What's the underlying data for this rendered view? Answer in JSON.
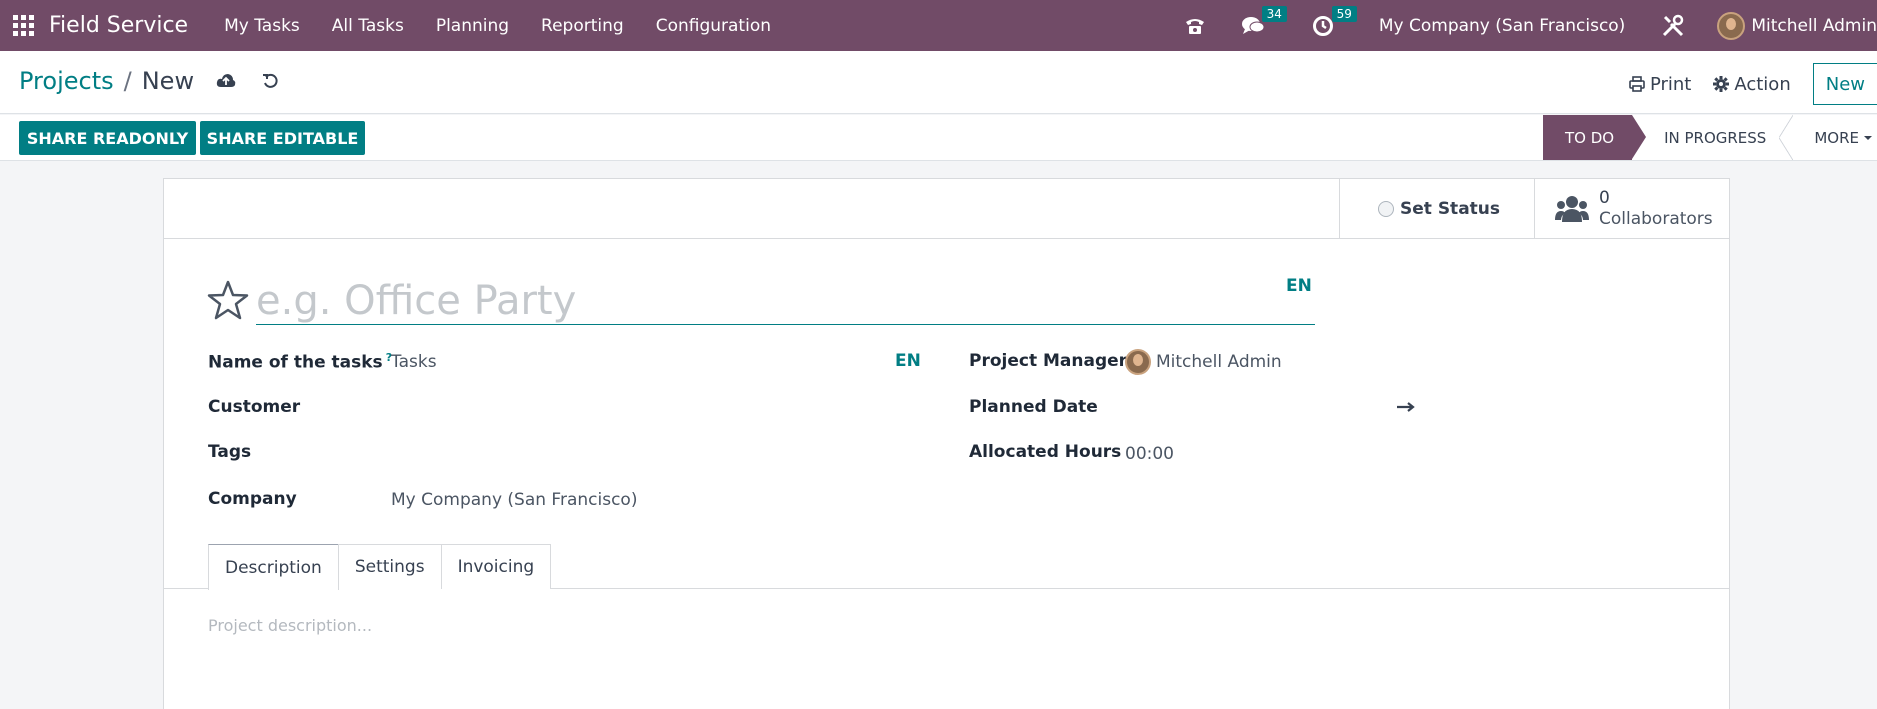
{
  "navbar": {
    "app_name": "Field Service",
    "menu": [
      "My Tasks",
      "All Tasks",
      "Planning",
      "Reporting",
      "Configuration"
    ],
    "messages_count": "34",
    "activities_count": "59",
    "company": "My Company (San Francisco)",
    "user": "Mitchell Admin",
    "accent": "#714b67"
  },
  "control": {
    "breadcrumb_parent": "Projects",
    "breadcrumb_current": "New",
    "print_label": "Print",
    "action_label": "Action",
    "new_label": "New"
  },
  "status": {
    "share_readonly": "SHARE READONLY",
    "share_editable": "SHARE EDITABLE",
    "stages": [
      "TO DO",
      "IN PROGRESS",
      "MORE"
    ],
    "active_stage": "TO DO"
  },
  "sheet": {
    "set_status": "Set Status",
    "collaborators_count": "0",
    "collaborators_label": "Collaborators",
    "title_placeholder": "e.g. Office Party",
    "lang": "EN",
    "fields_left": {
      "tasks_name_label": "Name of the tasks",
      "tasks_name_help": "?",
      "tasks_name_value": "Tasks",
      "customer_label": "Customer",
      "tags_label": "Tags",
      "company_label": "Company",
      "company_value": "My Company (San Francisco)"
    },
    "fields_right": {
      "project_manager_label": "Project Manager",
      "project_manager_value": "Mitchell Admin",
      "planned_date_label": "Planned Date",
      "allocated_hours_label": "Allocated Hours",
      "allocated_hours_value": "00:00"
    },
    "tabs": [
      "Description",
      "Settings",
      "Invoicing"
    ],
    "description_placeholder": "Project description..."
  }
}
